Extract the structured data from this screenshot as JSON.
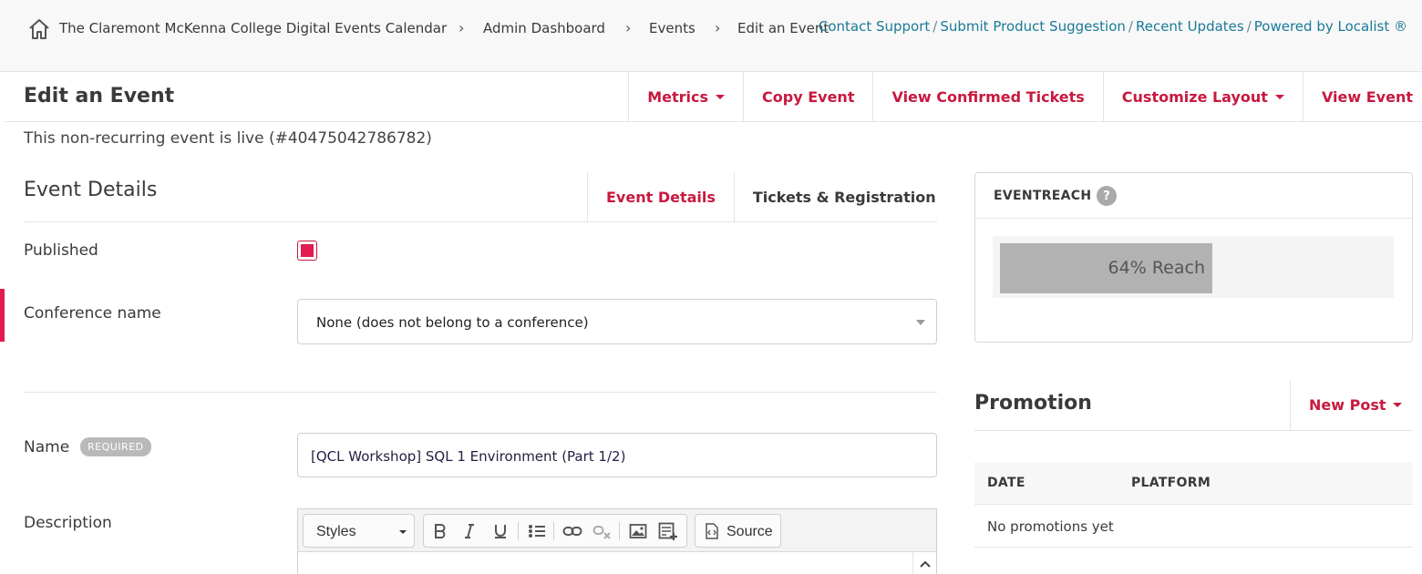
{
  "breadcrumb": {
    "items": [
      "The Claremont McKenna College Digital Events Calendar",
      "Admin Dashboard",
      "Events",
      "Edit an Event"
    ],
    "separator": "›"
  },
  "top_links": {
    "contact_support": "Contact Support",
    "submit_suggestion": "Submit Product Suggestion",
    "recent_updates": "Recent Updates",
    "powered_by": "Powered by Localist ®",
    "separator": "/"
  },
  "page": {
    "title": "Edit an Event",
    "tabs": [
      "Metrics",
      "Copy Event",
      "View Confirmed Tickets",
      "Customize Layout",
      "View Event"
    ],
    "status": "This non-recurring event is live (#40475042786782)"
  },
  "event_details": {
    "section_title": "Event Details",
    "tabs": [
      "Event Details",
      "Tickets & Registration"
    ],
    "active_tab": "Event Details",
    "published_label": "Published",
    "published_checked": true,
    "conference_label": "Conference name",
    "conference_value": "None (does not belong to a conference)",
    "name_label": "Name",
    "required_badge": "REQUIRED",
    "name_value": "[QCL Workshop] SQL 1 Environment (Part 1/2)",
    "description_label": "Description",
    "editor": {
      "styles_label": "Styles",
      "source_label": "Source",
      "buttons": [
        "bold-icon",
        "italic-icon",
        "underline-icon",
        "bulleted-list-icon",
        "link-icon",
        "unlink-icon",
        "image-icon",
        "insert-widget-icon",
        "source-icon"
      ]
    }
  },
  "eventreach": {
    "title": "EVENTREACH",
    "help": "?",
    "reach_label": "64% Reach",
    "reach_fraction": 0.55
  },
  "promotion": {
    "title": "Promotion",
    "new_post": "New Post",
    "columns": [
      "DATE",
      "PLATFORM"
    ],
    "empty_text": "No promotions yet"
  },
  "colors": {
    "accent": "#c8193f",
    "link": "#1a7a96",
    "reach_bar": "#b2b2b2"
  }
}
